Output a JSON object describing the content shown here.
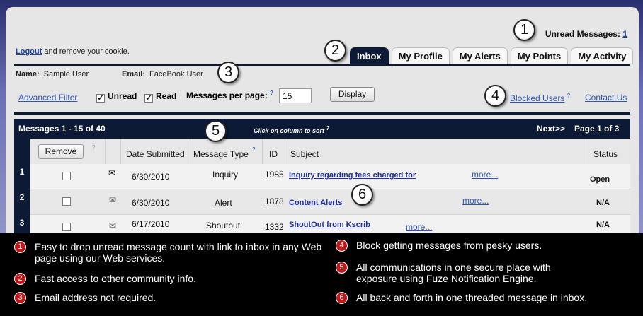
{
  "header": {
    "unread_label": "Unread Messages:",
    "unread_count": "1",
    "logout_link": "Logout",
    "logout_text": "and remove your cookie."
  },
  "tabs": [
    {
      "label": "Inbox",
      "active": true
    },
    {
      "label": "My Profile"
    },
    {
      "label": "My Alerts"
    },
    {
      "label": "My Points"
    },
    {
      "label": "My Activity"
    }
  ],
  "user": {
    "name_label": "Name:",
    "name_value": "Sample User",
    "email_label": "Email:",
    "email_value": "FaceBook User"
  },
  "filters": {
    "advanced_filter": "Advanced Filter",
    "unread_label": "Unread",
    "read_label": "Read",
    "per_page_label": "Messages per page:",
    "per_page_help": "?",
    "per_page_value": "15",
    "display_button": "Display",
    "blocked_users": "Blocked Users",
    "blocked_help": "?",
    "contact_us": "Contact Us"
  },
  "table": {
    "range": "Messages 1 - 15 of 40",
    "sort_hint": "Click on column to sort",
    "sort_help": "?",
    "next": "Next>>",
    "page": "Page 1 of 3",
    "remove_button": "Remove",
    "remove_help": "?",
    "columns": {
      "date": "Date Submitted",
      "type": "Message Type",
      "type_help": "?",
      "id": "ID",
      "subject": "Subject",
      "status": "Status"
    },
    "rows": [
      {
        "num": "1",
        "date": "6/30/2010",
        "type": "Inquiry",
        "id": "1985",
        "subject": "Inquiry regarding fees charged for",
        "more": "more...",
        "status": "Open"
      },
      {
        "num": "2",
        "date": "6/30/2010",
        "type": "Alert",
        "id": "1878",
        "subject": "Content Alerts",
        "more": "more...",
        "status": "N/A"
      },
      {
        "num": "3",
        "date": "6/17/2010",
        "type": "Shoutout",
        "id": "1332",
        "subject": "ShoutOut from Kscrib",
        "more": "more...",
        "status": "N/A"
      }
    ]
  },
  "callouts": [
    "1",
    "2",
    "3",
    "4",
    "5",
    "6"
  ],
  "legend": [
    {
      "num": "1",
      "text": "Easy to drop unread message count with link to inbox in any Web page using our Web services."
    },
    {
      "num": "2",
      "text": "Fast access to other community info."
    },
    {
      "num": "3",
      "text": "Email address not required."
    },
    {
      "num": "4",
      "text": "Block getting messages from pesky users."
    },
    {
      "num": "5",
      "text": "All communications in one secure place with exposure using Fuze Notification Engine."
    },
    {
      "num": "6",
      "text": "All back and forth in one threaded message in inbox."
    }
  ],
  "colors": {
    "nav_dark": "#0c1a35",
    "link": "#2d55b8",
    "callout_red": "#c01818"
  },
  "icons": {
    "unread_message": "envelope-closed-icon",
    "read_message": "envelope-open-icon"
  }
}
